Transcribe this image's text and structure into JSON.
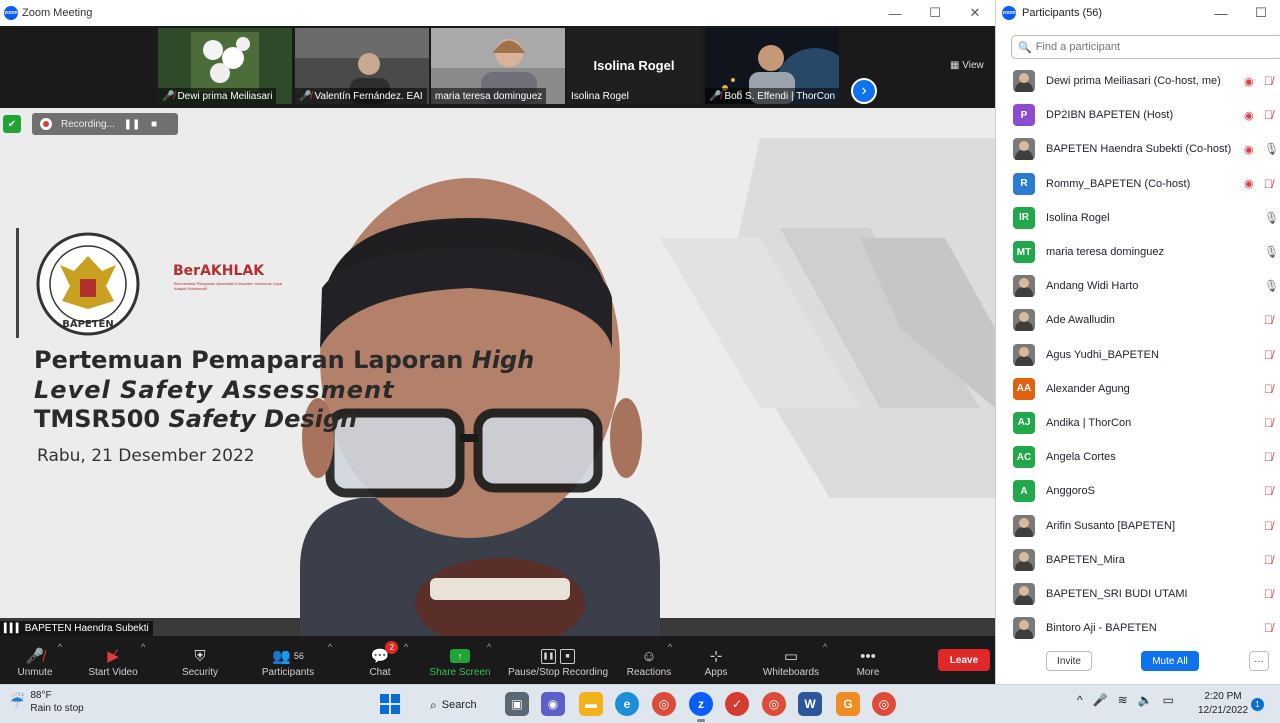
{
  "window": {
    "title": "Zoom Meeting"
  },
  "thumbnails": [
    {
      "name": "Dewi prima Meiliasari",
      "muted": true
    },
    {
      "name": "Valentín Fernández. EAI",
      "muted": true
    },
    {
      "name": "maria teresa dominguez",
      "muted": false
    },
    {
      "name": "Isolina Rogel",
      "big_name": "Isolina Rogel",
      "muted": false
    },
    {
      "name": "Bob S. Effendi | ThorCon",
      "muted": true
    }
  ],
  "view_label": "View",
  "recording": {
    "label": "Recording..."
  },
  "slide": {
    "line1_a": "Pertemuan Pemaparan Laporan ",
    "line1_b": "High",
    "line2": "Level    Safety    Assessment",
    "line3_a": "TMSR500 ",
    "line3_b": "Safety Design",
    "date": "Rabu, 21 Desember 2022",
    "brand": "BerAKHLAK",
    "brand_sub": "Berorientasi Pelayanan Akuntabel Kompeten Harmonis Loyal Adaptif Kolaboratif",
    "logo_text": "BAPETEN"
  },
  "speaker_name": "BAPETEN Haendra Subekti",
  "toolbar": {
    "unmute": "Unmute",
    "start_video": "Start Video",
    "security": "Security",
    "participants": "Participants",
    "participants_count": "56",
    "chat": "Chat",
    "chat_badge": "2",
    "share_screen": "Share Screen",
    "pause_stop": "Pause/Stop Recording",
    "reactions": "Reactions",
    "apps": "Apps",
    "whiteboards": "Whiteboards",
    "more": "More",
    "leave": "Leave"
  },
  "panel": {
    "title": "Participants (56)",
    "search_placeholder": "Find a participant",
    "invite": "Invite",
    "mute_all": "Mute All",
    "more": "···"
  },
  "participants": [
    {
      "name": "Dewi prima Meiliasari (Co-host, me)",
      "avatar": "photo",
      "video_off": true,
      "mic": "off"
    },
    {
      "name": "DP2IBN BAPETEN (Host)",
      "avatar": "P",
      "color": "#8e4bd0",
      "video_off": true,
      "mic": "off"
    },
    {
      "name": "BAPETEN Haendra Subekti (Co-host)",
      "avatar": "photo",
      "video_off": true,
      "mic": "on"
    },
    {
      "name": "Rommy_BAPETEN (Co-host)",
      "avatar": "R",
      "color": "#2b7bd0",
      "video_off": true,
      "mic": "off"
    },
    {
      "name": "Isolina Rogel",
      "avatar": "IR",
      "color": "#21a84a",
      "video_off": false,
      "mic": "on"
    },
    {
      "name": "maria teresa dominguez",
      "avatar": "MT",
      "color": "#21a84a",
      "video_off": false,
      "mic": "on"
    },
    {
      "name": "Andang Widi Harto",
      "avatar": "photo",
      "video_off": false,
      "mic": "on"
    },
    {
      "name": "Ade Awalludin",
      "avatar": "photo",
      "video_off": false,
      "mic": "off"
    },
    {
      "name": "Agus Yudhi_BAPETEN",
      "avatar": "photo",
      "video_off": false,
      "mic": "off"
    },
    {
      "name": "Alexander Agung",
      "avatar": "AA",
      "color": "#e0610e",
      "video_off": false,
      "mic": "off"
    },
    {
      "name": "Andika | ThorCon",
      "avatar": "AJ",
      "color": "#21a84a",
      "video_off": false,
      "mic": "off"
    },
    {
      "name": "Angela Cortes",
      "avatar": "AC",
      "color": "#21a84a",
      "video_off": false,
      "mic": "off"
    },
    {
      "name": "AnggoroS",
      "avatar": "A",
      "color": "#21a84a",
      "video_off": false,
      "mic": "off"
    },
    {
      "name": "Arifin Susanto [BAPETEN]",
      "avatar": "photo",
      "video_off": false,
      "mic": "off"
    },
    {
      "name": "BAPETEN_Mira",
      "avatar": "photo",
      "video_off": false,
      "mic": "off"
    },
    {
      "name": "BAPETEN_SRI BUDI UTAMI",
      "avatar": "photo",
      "video_off": false,
      "mic": "off"
    },
    {
      "name": "Bintoro Aji - BAPETEN",
      "avatar": "photo",
      "video_off": false,
      "mic": "off"
    }
  ],
  "taskbar": {
    "weather_temp": "88°F",
    "weather_desc": "Rain to stop",
    "search": "Search",
    "time": "2:20 PM",
    "date": "12/21/2022",
    "notifications": "1"
  }
}
